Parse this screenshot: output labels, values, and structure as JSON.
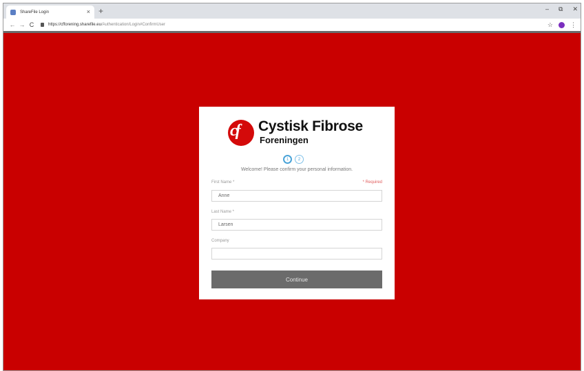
{
  "browser": {
    "tab_title": "ShareFile Login",
    "tab_close": "×",
    "new_tab": "+",
    "window_controls": [
      "–",
      "⧉",
      "✕"
    ],
    "url_host": "https://cfforening.sharefile.eu",
    "url_path": "/Authentication/Login#ConfirmUser",
    "back": "←",
    "forward": "→",
    "reload": "C",
    "star": "☆",
    "menu": "⋮"
  },
  "colors": {
    "page_background": "#c90000",
    "step_accent": "#4aa3d8",
    "continue_button": "#6b6b6b",
    "required_text": "#e05c5c",
    "logo_red": "#d40a0a"
  },
  "logo": {
    "mark": "cf",
    "title": "Cystisk Fibrose",
    "subtitle": "Foreningen"
  },
  "steps": [
    "1",
    "2"
  ],
  "welcome": "Welcome! Please confirm your personal information.",
  "form": {
    "required_note": "* Required",
    "first_name": {
      "label": "First Name *",
      "value": "Anne"
    },
    "last_name": {
      "label": "Last Name *",
      "value": "Larsen"
    },
    "company": {
      "label": "Company",
      "value": ""
    },
    "continue_label": "Continue"
  }
}
